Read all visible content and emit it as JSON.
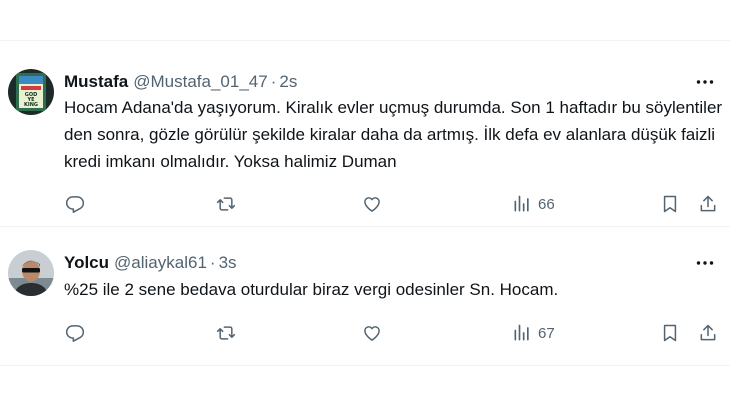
{
  "tweets": [
    {
      "name": "Mustafa",
      "handle": "@Mustafa_01_47",
      "separator": "·",
      "time": "2s",
      "text": "Hocam Adana'da yaşıyorum. Kiralık evler uçmuş durumda. Son 1 haftadır bu söylentiler den sonra, gözle görülür şekilde kiralar daha da artmış. İlk defa ev alanlara düşük faizli kredi imkanı olmalıdır. Yoksa halimiz Duman",
      "views": "66",
      "avatar_text": [
        "GOD",
        "YE",
        "KING"
      ]
    },
    {
      "name": "Yolcu",
      "handle": "@aliaykal61",
      "separator": "·",
      "time": "3s",
      "text": "%25 ile 2 sene bedava oturdular biraz vergi odesinler Sn. Hocam.",
      "views": "67"
    }
  ],
  "icons": {
    "reply": "reply-icon",
    "retweet": "retweet-icon",
    "like": "like-icon",
    "views": "views-icon",
    "bookmark": "bookmark-icon",
    "share": "share-icon",
    "more": "more-icon"
  },
  "colors": {
    "text": "#0f1419",
    "secondary": "#536471",
    "divider": "#eff3f4"
  }
}
